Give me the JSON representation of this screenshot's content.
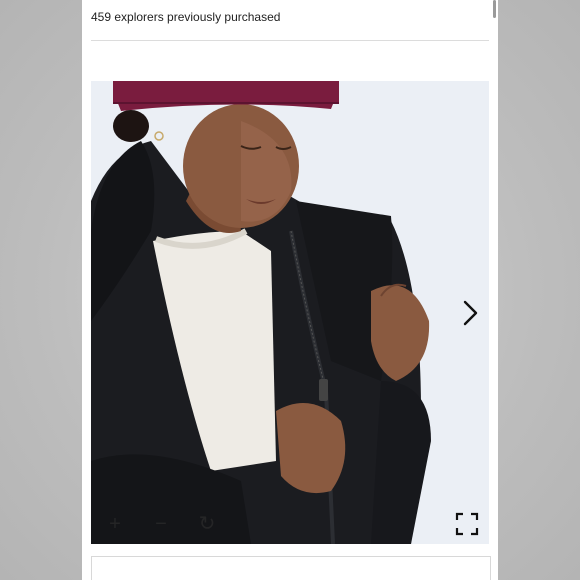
{
  "purchase": {
    "text": "459 explorers previously purchased"
  },
  "gallery": {
    "image_subject": "person-zipping-black-jacket",
    "icons": {
      "next": "chevron-right-icon",
      "zoom_in": "plus-icon",
      "zoom_out": "minus-icon",
      "rotate": "rotate-icon",
      "fullscreen": "fullscreen-icon"
    }
  },
  "colors": {
    "beanie": "#7a1c3e",
    "jacket": "#1a1b1e",
    "skin": "#8a5a40",
    "shirt": "#efece6",
    "background": "#eceff5"
  }
}
